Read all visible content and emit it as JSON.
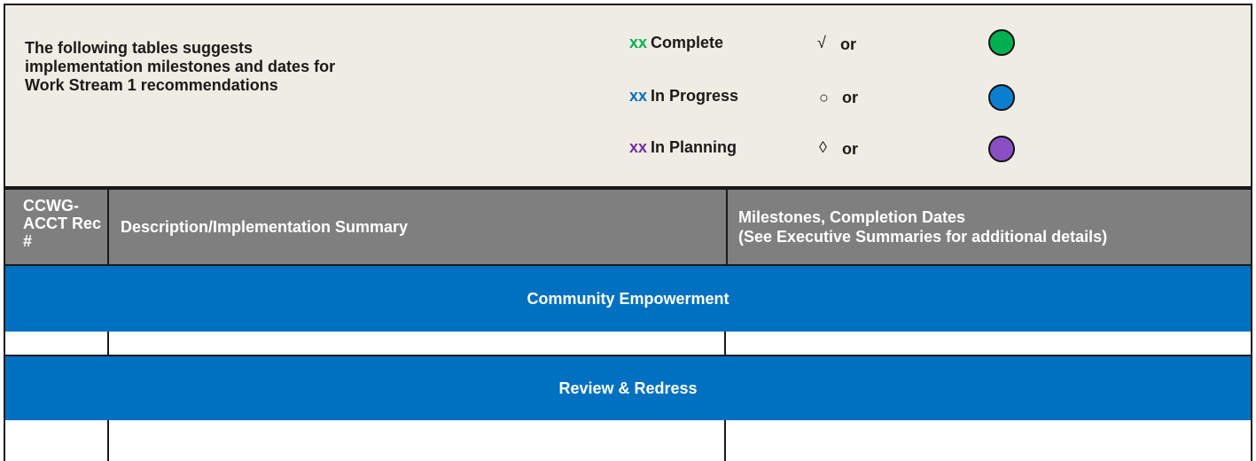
{
  "intro": {
    "text": "The following tables suggests implementation milestones and dates for Work Stream 1 recommendations"
  },
  "legend": [
    {
      "prefix": "xx",
      "label": "Complete",
      "symbol": "√",
      "or": "or",
      "color": "#00b050",
      "icon": "green-circle-icon"
    },
    {
      "prefix": "xx",
      "label": "In Progress",
      "symbol": "○",
      "or": "or",
      "color": "#0070c0",
      "icon": "blue-circle-icon"
    },
    {
      "prefix": "xx",
      "label": "In Planning",
      "symbol": "◊",
      "or": "or",
      "color": "#7030a0",
      "icon": "purple-circle-icon"
    }
  ],
  "columns": {
    "rec": "CCWG-ACCT Rec #",
    "description": "Description/Implementation Summary",
    "milestones_line1": "Milestones, Completion Dates",
    "milestones_line2": "(See Executive Summaries for additional details)"
  },
  "sections": [
    {
      "title": "Community Empowerment"
    },
    {
      "title": "Review & Redress"
    }
  ],
  "colors": {
    "header_bg": "#efece3",
    "column_header_bg": "#7f7f7f",
    "section_bg": "#0070c0"
  }
}
